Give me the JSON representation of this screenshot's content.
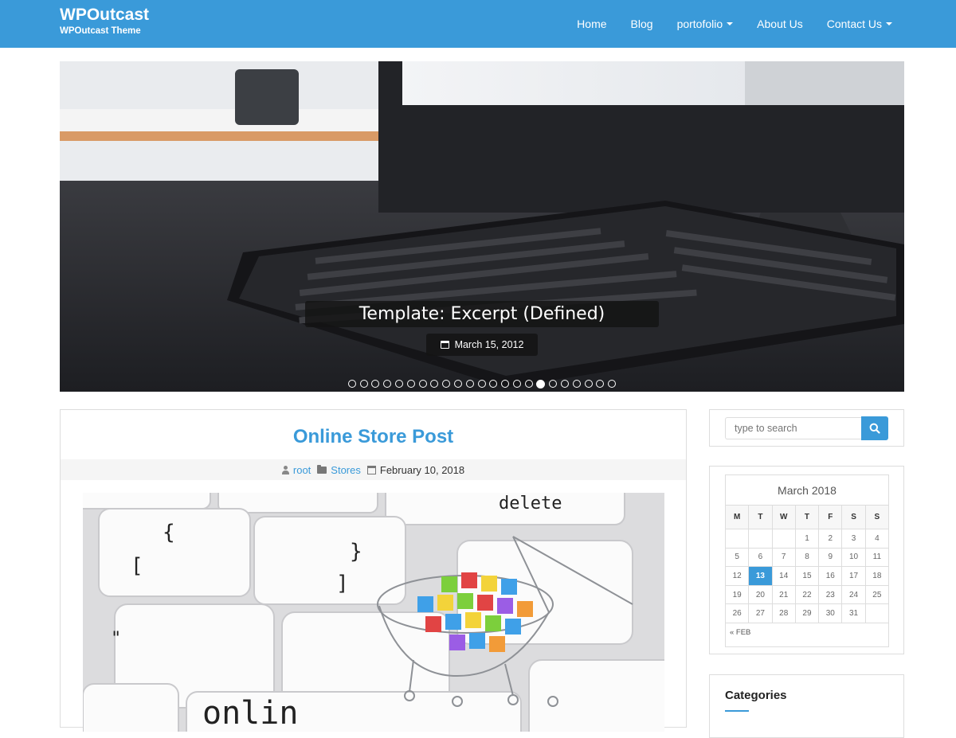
{
  "header": {
    "site_title": "WPOutcast",
    "tagline": "WPOutcast Theme",
    "nav": [
      {
        "label": "Home",
        "dropdown": false
      },
      {
        "label": "Blog",
        "dropdown": false
      },
      {
        "label": "portofolio",
        "dropdown": true
      },
      {
        "label": "About Us",
        "dropdown": false
      },
      {
        "label": "Contact Us",
        "dropdown": true
      }
    ]
  },
  "slider": {
    "caption_title": "Template: Excerpt (Defined)",
    "caption_date": "March 15, 2012",
    "dots_total": 23,
    "active_dot": 16
  },
  "post": {
    "title": "Online Store Post",
    "author": "root",
    "category": "Stores",
    "date": "February 10, 2018",
    "image_keys": [
      "delete",
      "{",
      "[",
      "}",
      "]",
      "\"",
      "onlin"
    ]
  },
  "sidebar": {
    "search_placeholder": "type to search",
    "calendar": {
      "caption": "March 2018",
      "weekdays": [
        "M",
        "T",
        "W",
        "T",
        "F",
        "S",
        "S"
      ],
      "weeks": [
        [
          "",
          "",
          "",
          "1",
          "2",
          "3",
          "4"
        ],
        [
          "5",
          "6",
          "7",
          "8",
          "9",
          "10",
          "11"
        ],
        [
          "12",
          "13",
          "14",
          "15",
          "16",
          "17",
          "18"
        ],
        [
          "19",
          "20",
          "21",
          "22",
          "23",
          "24",
          "25"
        ],
        [
          "26",
          "27",
          "28",
          "29",
          "30",
          "31",
          ""
        ]
      ],
      "today": "13",
      "prev_label": "« FEB"
    },
    "categories_title": "Categories"
  },
  "colors": {
    "accent": "#3a9ad9",
    "header_bg": "#3a9ad9"
  }
}
